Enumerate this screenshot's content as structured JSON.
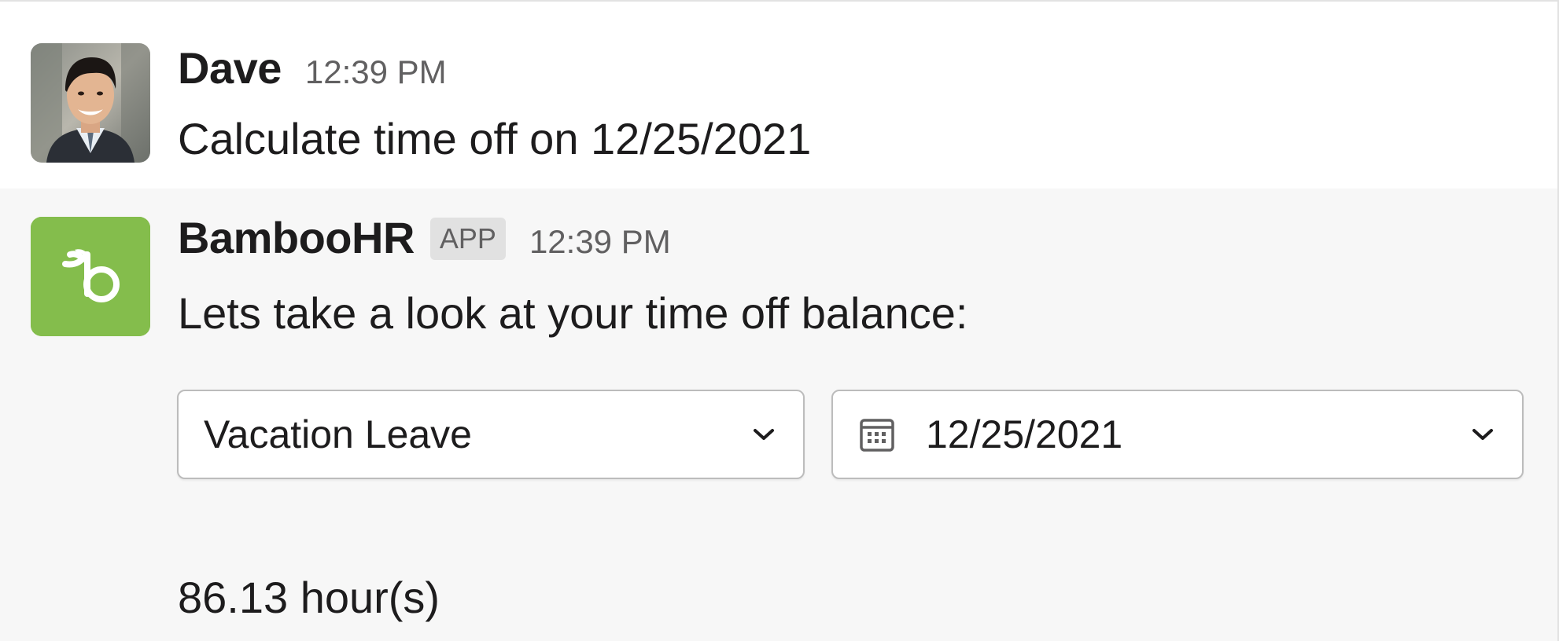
{
  "messages": {
    "user": {
      "sender": "Dave",
      "time": "12:39 PM",
      "text": "Calculate time off on 12/25/2021"
    },
    "bot": {
      "sender": "BambooHR",
      "badge": "APP",
      "time": "12:39 PM",
      "text": "Lets take a look at your time off balance:",
      "type_select": {
        "value": "Vacation Leave",
        "icon": "chevron-down-icon"
      },
      "date_select": {
        "value": "12/25/2021",
        "icon": "calendar-icon"
      },
      "result": "86.13 hour(s)"
    }
  },
  "colors": {
    "bamboo_green": "#84bd4c",
    "bot_background": "#f7f7f7",
    "muted_text": "#616061"
  }
}
